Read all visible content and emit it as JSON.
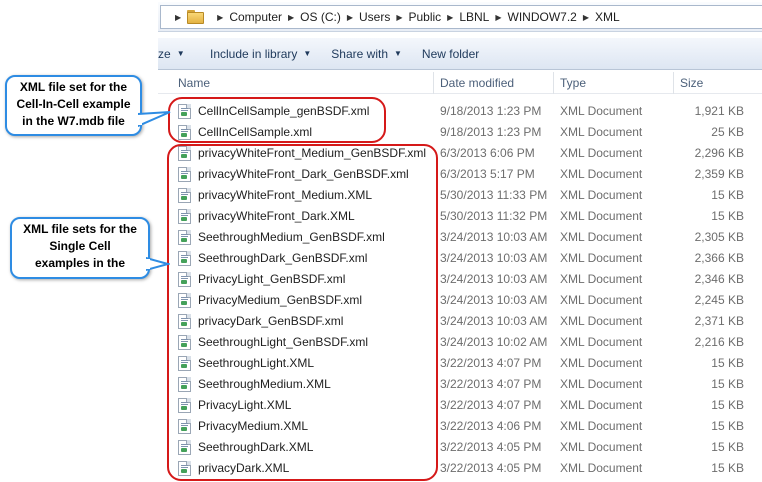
{
  "breadcrumb": {
    "segments": [
      "Computer",
      "OS (C:)",
      "Users",
      "Public",
      "LBNL",
      "WINDOW7.2",
      "XML"
    ]
  },
  "toolbar": {
    "organize_label": "ze",
    "include_label": "Include in library",
    "share_label": "Share with",
    "new_folder_label": "New folder"
  },
  "columns": {
    "name": "Name",
    "date": "Date modified",
    "type": "Type",
    "size": "Size"
  },
  "files": [
    {
      "name": "CellInCellSample_genBSDF.xml",
      "date": "9/18/2013 1:23 PM",
      "type": "XML Document",
      "size": "1,921 KB"
    },
    {
      "name": "CellInCellSample.xml",
      "date": "9/18/2013 1:23 PM",
      "type": "XML Document",
      "size": "25 KB"
    },
    {
      "name": "privacyWhiteFront_Medium_GenBSDF.xml",
      "date": "6/3/2013 6:06 PM",
      "type": "XML Document",
      "size": "2,296 KB"
    },
    {
      "name": "privacyWhiteFront_Dark_GenBSDF.xml",
      "date": "6/3/2013 5:17 PM",
      "type": "XML Document",
      "size": "2,359 KB"
    },
    {
      "name": "privacyWhiteFront_Medium.XML",
      "date": "5/30/2013 11:33 PM",
      "type": "XML Document",
      "size": "15 KB"
    },
    {
      "name": "privacyWhiteFront_Dark.XML",
      "date": "5/30/2013 11:32 PM",
      "type": "XML Document",
      "size": "15 KB"
    },
    {
      "name": "SeethroughMedium_GenBSDF.xml",
      "date": "3/24/2013 10:03 AM",
      "type": "XML Document",
      "size": "2,305 KB"
    },
    {
      "name": "SeethroughDark_GenBSDF.xml",
      "date": "3/24/2013 10:03 AM",
      "type": "XML Document",
      "size": "2,366 KB"
    },
    {
      "name": "PrivacyLight_GenBSDF.xml",
      "date": "3/24/2013 10:03 AM",
      "type": "XML Document",
      "size": "2,346 KB"
    },
    {
      "name": "PrivacyMedium_GenBSDF.xml",
      "date": "3/24/2013 10:03 AM",
      "type": "XML Document",
      "size": "2,245 KB"
    },
    {
      "name": "privacyDark_GenBSDF.xml",
      "date": "3/24/2013 10:03 AM",
      "type": "XML Document",
      "size": "2,371 KB"
    },
    {
      "name": "SeethroughLight_GenBSDF.xml",
      "date": "3/24/2013 10:02 AM",
      "type": "XML Document",
      "size": "2,216 KB"
    },
    {
      "name": "SeethroughLight.XML",
      "date": "3/22/2013 4:07 PM",
      "type": "XML Document",
      "size": "15 KB"
    },
    {
      "name": "SeethroughMedium.XML",
      "date": "3/22/2013 4:07 PM",
      "type": "XML Document",
      "size": "15 KB"
    },
    {
      "name": "PrivacyLight.XML",
      "date": "3/22/2013 4:07 PM",
      "type": "XML Document",
      "size": "15 KB"
    },
    {
      "name": "PrivacyMedium.XML",
      "date": "3/22/2013 4:06 PM",
      "type": "XML Document",
      "size": "15 KB"
    },
    {
      "name": "SeethroughDark.XML",
      "date": "3/22/2013 4:05 PM",
      "type": "XML Document",
      "size": "15 KB"
    },
    {
      "name": "privacyDark.XML",
      "date": "3/22/2013 4:05 PM",
      "type": "XML Document",
      "size": "15 KB"
    }
  ],
  "callouts": {
    "cell_in_cell": {
      "line1": "XML file set for the",
      "line2": "Cell-In-Cell example",
      "line3": "in the W7.mdb file"
    },
    "single_cell": {
      "line1": "XML file sets for the",
      "line2": "Single Cell",
      "line3": "examples in the"
    }
  },
  "colors": {
    "highlight_outline": "#d51919",
    "callout_border": "#2e8ce3",
    "toolbar_text": "#1e395b"
  }
}
